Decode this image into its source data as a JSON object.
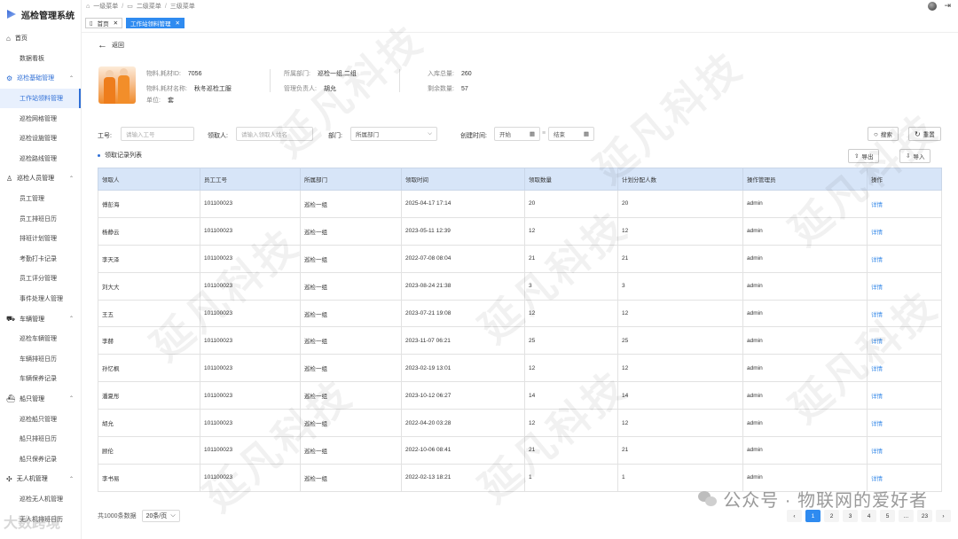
{
  "app": {
    "title": "巡检管理系统"
  },
  "sidebar": {
    "groups": [
      {
        "label": "首页",
        "icon": "home-icon",
        "items": [
          "数据看板"
        ]
      },
      {
        "label": "巡检基础管理",
        "icon": "settings-icon",
        "items": [
          "工作站领料管理",
          "巡检网格管理",
          "巡检设施管理",
          "巡检路线管理"
        ]
      },
      {
        "label": "巡检人员管理",
        "icon": "user-icon",
        "items": [
          "员工管理",
          "员工排班日历",
          "排班计划管理",
          "考勤打卡记录",
          "员工评分管理",
          "事件处理人管理"
        ]
      },
      {
        "label": "车辆管理",
        "icon": "car-icon",
        "items": [
          "巡检车辆管理",
          "车辆排班日历",
          "车辆保养记录"
        ]
      },
      {
        "label": "船只管理",
        "icon": "ship-icon",
        "items": [
          "巡检船只管理",
          "船只排班日历",
          "船只保养记录"
        ]
      },
      {
        "label": "无人机管理",
        "icon": "drone-icon",
        "items": [
          "巡检无人机管理",
          "无人机排班日历"
        ]
      }
    ]
  },
  "breadcrumb": {
    "l1": "一级菜单",
    "l2": "二级菜单",
    "l3": "三级菜单"
  },
  "tabs": {
    "home": "首页",
    "current": "工作站领料管理"
  },
  "back_label": "返回",
  "material": {
    "id_label": "物料,耗材ID:",
    "id": "7056",
    "name_label": "物料,耗材名称:",
    "name": "秋冬巡检工服",
    "unit_label": "单位:",
    "unit": "套",
    "dept_label": "所属部门:",
    "dept": "巡检一组,二组",
    "owner_label": "管理负责人:",
    "owner": "胡允",
    "in_label": "入库总量:",
    "in_total": "260",
    "remain_label": "剩余数量:",
    "remain": "57"
  },
  "filters": {
    "emp_no_label": "工号:",
    "emp_no_placeholder": "请输入工号",
    "receiver_label": "领取人:",
    "receiver_placeholder": "请输入领取人姓名",
    "dept_label": "部门:",
    "dept_value": "所属部门",
    "created_label": "创建时间:",
    "start": "开始",
    "end": "结束",
    "search": "搜索",
    "reset": "重置"
  },
  "list": {
    "title": "领取记录列表",
    "export": "导出",
    "import": "导入"
  },
  "table": {
    "headers": [
      "领取人",
      "员工工号",
      "所属部门",
      "领取时间",
      "领取数量",
      "计划分配人数",
      "操作管理员",
      "操作"
    ],
    "rows": [
      [
        "傅彭海",
        "101100023",
        "巡检一组",
        "2025-04-17 17:14",
        "20",
        "20",
        "admin",
        "详情"
      ],
      [
        "杨静云",
        "101100023",
        "巡检一组",
        "2023-05-11 12:39",
        "12",
        "12",
        "admin",
        "详情"
      ],
      [
        "李天泽",
        "101100023",
        "巡检一组",
        "2022-07-08 08:04",
        "21",
        "21",
        "admin",
        "详情"
      ],
      [
        "刘大大",
        "101100023",
        "巡检一组",
        "2023-08-24 21:38",
        "3",
        "3",
        "admin",
        "详情"
      ],
      [
        "王五",
        "101100023",
        "巡检一组",
        "2023-07-21 19:08",
        "12",
        "12",
        "admin",
        "详情"
      ],
      [
        "李赫",
        "101100023",
        "巡检一组",
        "2023-11-07 06:21",
        "25",
        "25",
        "admin",
        "详情"
      ],
      [
        "孙忆枫",
        "101100023",
        "巡检一组",
        "2023-02-19 13:01",
        "12",
        "12",
        "admin",
        "详情"
      ],
      [
        "潘夏彤",
        "101100023",
        "巡检一组",
        "2023-10-12 06:27",
        "14",
        "14",
        "admin",
        "详情"
      ],
      [
        "胡允",
        "101100023",
        "巡检一组",
        "2022-04-20 03:28",
        "12",
        "12",
        "admin",
        "详情"
      ],
      [
        "顾伦",
        "101100023",
        "巡检一组",
        "2022-10-06 08:41",
        "21",
        "21",
        "admin",
        "详情"
      ],
      [
        "李书易",
        "101100023",
        "巡检一组",
        "2022-02-13 18:21",
        "1",
        "1",
        "admin",
        "详情"
      ]
    ]
  },
  "pagination": {
    "total_text": "共1000条数据",
    "page_size": "20条/页",
    "pages": [
      "1",
      "2",
      "3",
      "4",
      "5",
      "...",
      "23"
    ]
  },
  "watermark": {
    "wechat": "公众号 · 物联网的爱好者",
    "corner": "大数跨境"
  }
}
